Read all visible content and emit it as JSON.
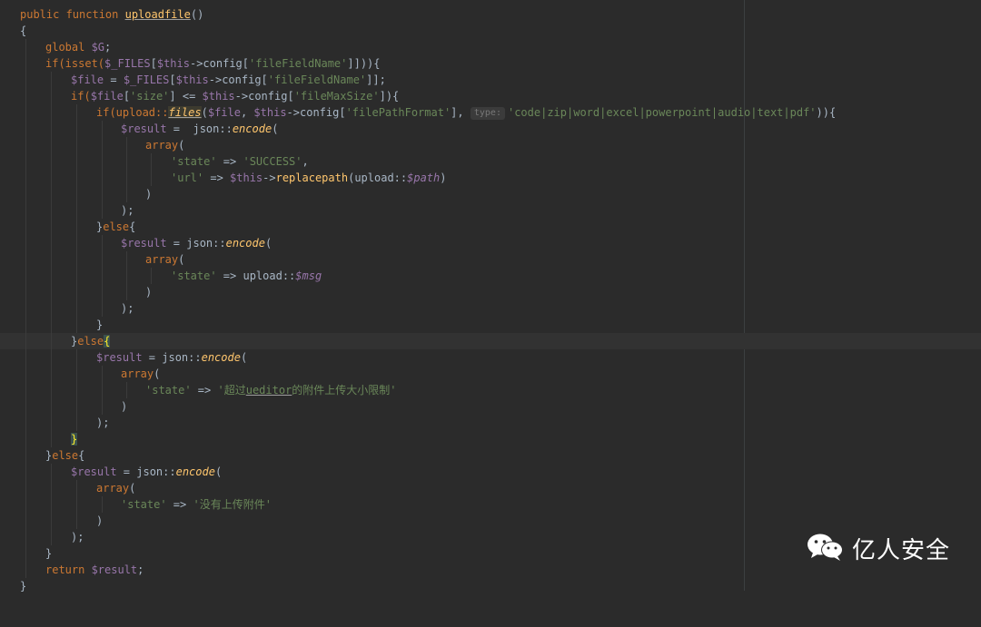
{
  "watermark": {
    "text": "亿人安全",
    "icon": "wechat-icon"
  },
  "code": {
    "l1": {
      "kw": "public function ",
      "name": "uploadfile",
      "rest": "()"
    },
    "l2": {
      "t": "{"
    },
    "l3": {
      "kw": "global ",
      "var": "$G",
      "rest": ";"
    },
    "l4": {
      "a": "if(isset(",
      "v1": "$_FILES",
      "b": "[",
      "v2": "$this",
      "c": "->config[",
      "s": "'fileFieldName'",
      "d": "]])){"
    },
    "l5": {
      "v1": "$file",
      "a": " = ",
      "v2": "$_FILES",
      "b": "[",
      "v3": "$this",
      "c": "->config[",
      "s": "'fileFieldName'",
      "d": "]];"
    },
    "l6": {
      "a": "if(",
      "v1": "$file",
      "b": "[",
      "s": "'size'",
      "c": "] <= ",
      "v2": "$this",
      "d": "->config[",
      "s2": "'fileMaxSize'",
      "e": "]){"
    },
    "l7": {
      "a": "if(upload::",
      "m": "files",
      "b": "(",
      "v1": "$file",
      "c": ", ",
      "v2": "$this",
      "d": "->config[",
      "s": "'filePathFormat'",
      "e": "], ",
      "hint": "type:",
      "s2": "'code|zip|word|excel|powerpoint|audio|text|pdf'",
      "f": ")){"
    },
    "l8": {
      "v": "$result",
      "a": " =  json::",
      "m": "encode",
      "b": "("
    },
    "l9": {
      "kw": "array",
      "a": "("
    },
    "l10": {
      "s": "'state'",
      "a": " => ",
      "s2": "'SUCCESS'",
      "b": ","
    },
    "l11": {
      "s": "'url'",
      "a": " => ",
      "v": "$this",
      "b": "->",
      "m": "replacepath",
      "c": "(upload::",
      "sv": "$path",
      "d": ")"
    },
    "l12": {
      "t": ")"
    },
    "l13": {
      "t": ");"
    },
    "l14": {
      "a": "}",
      "kw": "else",
      "b": "{"
    },
    "l15": {
      "v": "$result",
      "a": " = json::",
      "m": "encode",
      "b": "("
    },
    "l16": {
      "kw": "array",
      "a": "("
    },
    "l17": {
      "s": "'state'",
      "a": " => upload::",
      "sv": "$msg"
    },
    "l18": {
      "t": ")"
    },
    "l19": {
      "t": ");"
    },
    "l20": {
      "t": "}"
    },
    "l21": {
      "a": "}",
      "kw": "else",
      "b": "{"
    },
    "l22": {
      "v": "$result",
      "a": " = json::",
      "m": "encode",
      "b": "("
    },
    "l23": {
      "kw": "array",
      "a": "("
    },
    "l24": {
      "s": "'state'",
      "a": " => ",
      "s2a": "'超过",
      "s2b": "ueditor",
      "s2c": "的附件上传大小限制'"
    },
    "l25": {
      "t": ")"
    },
    "l26": {
      "t": ");"
    },
    "l27": {
      "t": "}"
    },
    "l28": {
      "a": "}",
      "kw": "else",
      "b": "{"
    },
    "l29": {
      "v": "$result",
      "a": " = json::",
      "m": "encode",
      "b": "("
    },
    "l30": {
      "kw": "array",
      "a": "("
    },
    "l31": {
      "s": "'state'",
      "a": " => ",
      "s2": "'没有上传附件'"
    },
    "l32": {
      "t": ")"
    },
    "l33": {
      "t": ");"
    },
    "l34": {
      "t": "}"
    },
    "l35": {
      "kw": "return ",
      "v": "$result",
      "a": ";"
    },
    "l36": {
      "t": "}"
    }
  }
}
